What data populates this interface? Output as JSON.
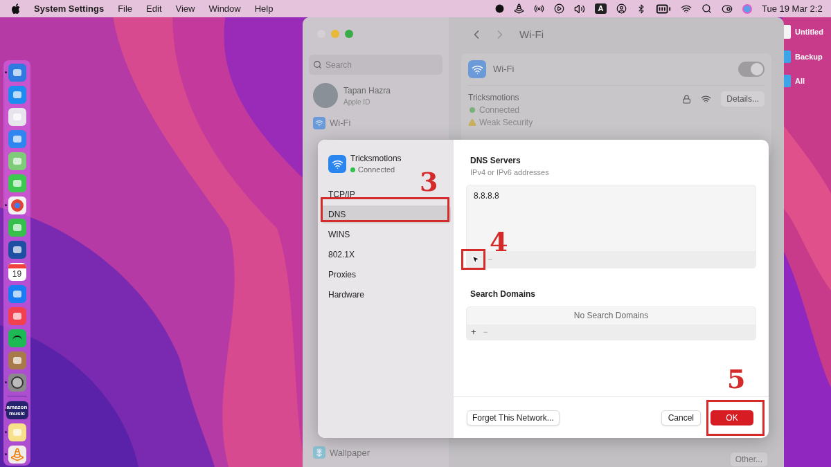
{
  "menu_bar": {
    "app_name": "System Settings",
    "menus": [
      "File",
      "Edit",
      "View",
      "Window",
      "Help"
    ],
    "input_source": "A",
    "clock": "Tue 19 Mar  2:2"
  },
  "desktop_items": [
    {
      "label": "Untitled",
      "kind": "document"
    },
    {
      "label": "Backup",
      "kind": "folder"
    },
    {
      "label": "All",
      "kind": "folder"
    }
  ],
  "dock": [
    {
      "kind": "finder",
      "running": true
    },
    {
      "kind": "safari",
      "running": false
    },
    {
      "kind": "launchpad",
      "running": false
    },
    {
      "kind": "mail",
      "running": false
    },
    {
      "kind": "maps",
      "running": false
    },
    {
      "kind": "messages",
      "running": false
    },
    {
      "kind": "chrome",
      "running": true
    },
    {
      "kind": "facetime",
      "running": false
    },
    {
      "kind": "bmail",
      "running": false
    },
    {
      "kind": "calendar",
      "label": "19",
      "running": false
    },
    {
      "kind": "appstore",
      "running": false
    },
    {
      "kind": "music",
      "running": false
    },
    {
      "kind": "spotify",
      "running": false
    },
    {
      "kind": "brown",
      "running": false
    },
    {
      "kind": "settings",
      "running": true
    },
    {
      "kind": "separator"
    },
    {
      "kind": "amazon",
      "label": "amazon music",
      "running": true
    },
    {
      "kind": "notes",
      "running": true
    },
    {
      "kind": "vlc",
      "running": true
    }
  ],
  "settings_window": {
    "search": {
      "placeholder": "Search"
    },
    "account": {
      "name": "Tapan Hazra",
      "subtitle": "Apple ID"
    },
    "sidebar": {
      "items": [
        {
          "label": "Wi-Fi",
          "kind": "wifi"
        },
        {
          "label": "Wallpaper",
          "kind": "wallpaper"
        }
      ]
    },
    "title": "Wi-Fi",
    "wifi": {
      "label": "Wi-Fi",
      "on": true
    },
    "network": {
      "name": "Tricksmotions",
      "statuses": [
        {
          "kind": "ok",
          "text": "Connected"
        },
        {
          "kind": "warning",
          "text": "Weak Security"
        }
      ],
      "details_button": "Details..."
    },
    "other_button": "Other..."
  },
  "dialog": {
    "network": {
      "name": "Tricksmotions",
      "status": "Connected"
    },
    "tabs": [
      {
        "label": "TCP/IP",
        "selected": false
      },
      {
        "label": "DNS",
        "selected": true
      },
      {
        "label": "WINS",
        "selected": false
      },
      {
        "label": "802.1X",
        "selected": false
      },
      {
        "label": "Proxies",
        "selected": false
      },
      {
        "label": "Hardware",
        "selected": false
      }
    ],
    "dns_servers": {
      "title": "DNS Servers",
      "subtitle": "IPv4 or IPv6 addresses",
      "entries": [
        "8.8.8.8"
      ]
    },
    "search_domains": {
      "title": "Search Domains",
      "empty_text": "No Search Domains"
    },
    "plus": "+",
    "minus": "−",
    "buttons": {
      "forget": "Forget This Network...",
      "cancel": "Cancel",
      "ok": "OK"
    }
  },
  "annotations": [
    {
      "number": "3"
    },
    {
      "number": "4"
    },
    {
      "number": "5"
    }
  ]
}
